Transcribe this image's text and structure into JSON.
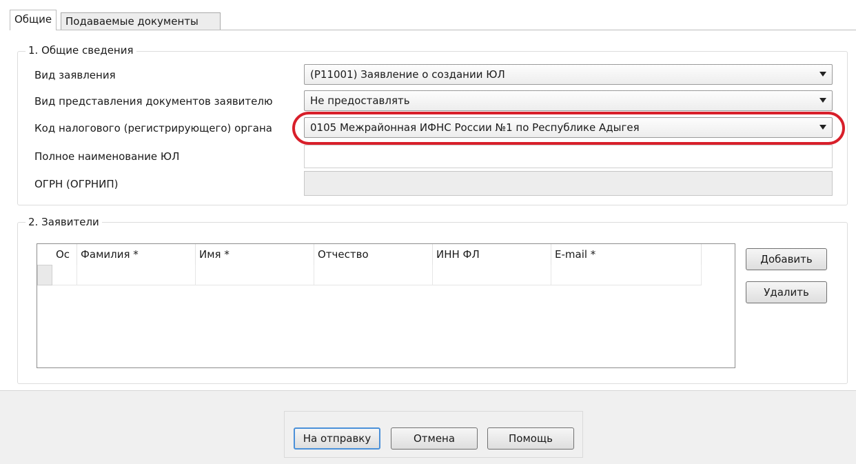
{
  "tabs": [
    {
      "label": "Общие"
    },
    {
      "label": "Подаваемые документы"
    }
  ],
  "section1": {
    "title": "1. Общие сведения",
    "rows": [
      {
        "label": "Вид заявления",
        "value": "(Р11001) Заявление о создании ЮЛ"
      },
      {
        "label": "Вид представления документов заявителю",
        "value": "Не предоставлять"
      },
      {
        "label": "Код налогового (регистрирующего) органа",
        "value": "0105 Межрайонная ИФНС России №1 по Республике Адыгея"
      },
      {
        "label": "Полное наименование ЮЛ",
        "value": ""
      },
      {
        "label": "ОГРН (ОГРНИП)",
        "value": ""
      }
    ]
  },
  "section2": {
    "title": "2. Заявители",
    "columns": [
      "Ос",
      "Фамилия *",
      "Имя *",
      "Отчество",
      "ИНН ФЛ",
      "E-mail *"
    ],
    "add_label": "Добавить",
    "delete_label": "Удалить"
  },
  "footer": {
    "send_label": "На отправку",
    "cancel_label": "Отмена",
    "help_label": "Помощь"
  },
  "colors": {
    "highlight": "#d81f2a",
    "focus": "#4a90d9"
  }
}
